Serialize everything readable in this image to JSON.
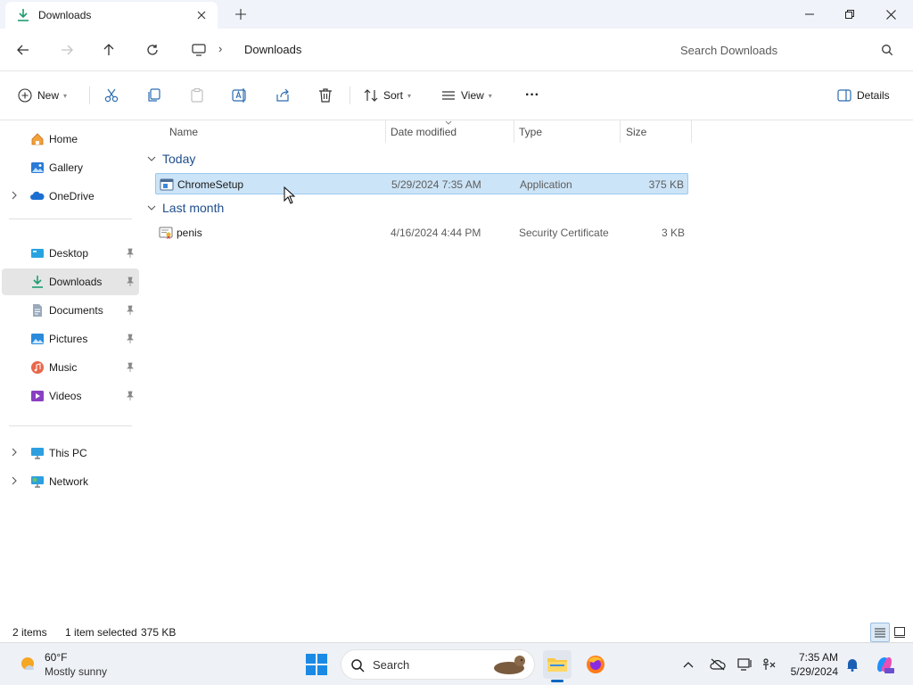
{
  "window": {
    "tab_title": "Downloads",
    "new_tab_symbol": "+",
    "minimize_symbol": "—",
    "close_symbol": "✕"
  },
  "address": {
    "breadcrumb_separator": "›",
    "current_folder": "Downloads",
    "search_placeholder": "Search Downloads"
  },
  "commands": {
    "new_label": "New",
    "sort_label": "Sort",
    "view_label": "View",
    "more_label": "···",
    "details_label": "Details"
  },
  "sidebar": {
    "items": [
      {
        "label": "Home",
        "icon": "home-icon"
      },
      {
        "label": "Gallery",
        "icon": "gallery-icon"
      },
      {
        "label": "OneDrive",
        "icon": "onedrive-icon"
      },
      {
        "label": "Desktop",
        "icon": "desktop-icon"
      },
      {
        "label": "Downloads",
        "icon": "downloads-icon"
      },
      {
        "label": "Documents",
        "icon": "documents-icon"
      },
      {
        "label": "Pictures",
        "icon": "pictures-icon"
      },
      {
        "label": "Music",
        "icon": "music-icon"
      },
      {
        "label": "Videos",
        "icon": "videos-icon"
      },
      {
        "label": "This PC",
        "icon": "this-pc-icon"
      },
      {
        "label": "Network",
        "icon": "network-icon"
      }
    ]
  },
  "columns": {
    "name": "Name",
    "date_modified": "Date modified",
    "type": "Type",
    "size": "Size"
  },
  "groups": [
    {
      "label": "Today",
      "files": [
        {
          "name": "ChromeSetup",
          "date": "5/29/2024 7:35 AM",
          "type": "Application",
          "size": "375 KB",
          "selected": true
        }
      ]
    },
    {
      "label": "Last month",
      "files": [
        {
          "name": "penis",
          "date": "4/16/2024 4:44 PM",
          "type": "Security Certificate",
          "size": "3 KB",
          "selected": false
        }
      ]
    }
  ],
  "status": {
    "item_count": "2 items",
    "selection": "1 item selected",
    "selection_size": "375 KB"
  },
  "taskbar": {
    "weather_temp": "60°F",
    "weather_desc": "Mostly sunny",
    "search_label": "Search",
    "time": "7:35 AM",
    "date": "5/29/2024"
  },
  "colors": {
    "accent": "#0067c0",
    "selection_bg": "#cce4f7",
    "selection_border": "#99c9ef",
    "group_label": "#1f4e8c"
  }
}
